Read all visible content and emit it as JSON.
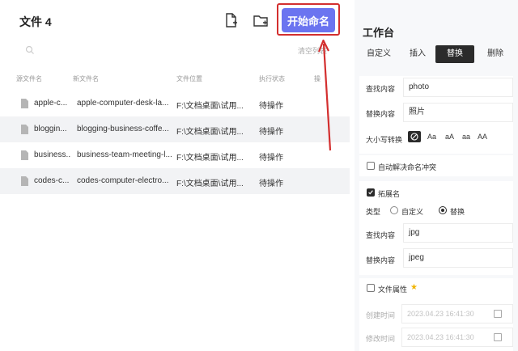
{
  "header": {
    "title": "文件 4",
    "start_button": "开始命名",
    "clear_list": "清空列表"
  },
  "table": {
    "columns": [
      "源文件名",
      "新文件名",
      "文件位置",
      "执行状态",
      "操"
    ],
    "rows": [
      {
        "source": "apple-c...",
        "new": "apple-computer-desk-la...",
        "location": "F:\\文档桌面\\试用...",
        "status": "待操作"
      },
      {
        "source": "bloggin...",
        "new": "blogging-business-coffe...",
        "location": "F:\\文档桌面\\试用...",
        "status": "待操作"
      },
      {
        "source": "business...",
        "new": "business-team-meeting-l...",
        "location": "F:\\文档桌面\\试用...",
        "status": "待操作"
      },
      {
        "source": "codes-c...",
        "new": "codes-computer-electro...",
        "location": "F:\\文档桌面\\试用...",
        "status": "待操作"
      }
    ]
  },
  "workspace": {
    "title": "工作台",
    "tabs": [
      "自定义",
      "插入",
      "替换",
      "删除"
    ],
    "active_tab": "替换",
    "find_label": "查找内容",
    "find_value": "photo",
    "replace_label": "替换内容",
    "replace_value": "照片",
    "case_label": "大小写转换",
    "case_options": [
      "Aa",
      "aA",
      "aa",
      "AA"
    ],
    "auto_conflict_label": "自动解决命名冲突",
    "extension_label": "拓展名",
    "type_label": "类型",
    "type_options": [
      "自定义",
      "替换"
    ],
    "type_selected": "替换",
    "ext_find_label": "查找内容",
    "ext_find_value": "jpg",
    "ext_replace_label": "替换内容",
    "ext_replace_value": "jpeg",
    "file_attr_label": "文件属性",
    "created_label": "创建时间",
    "created_value": "2023.04.23 16:41:30",
    "modified_label": "修改时间",
    "modified_value": "2023.04.23 16:41:30"
  },
  "colors": {
    "accent": "#6b74f0",
    "highlight_red": "#d32f2f",
    "dark": "#2b2b2b"
  }
}
